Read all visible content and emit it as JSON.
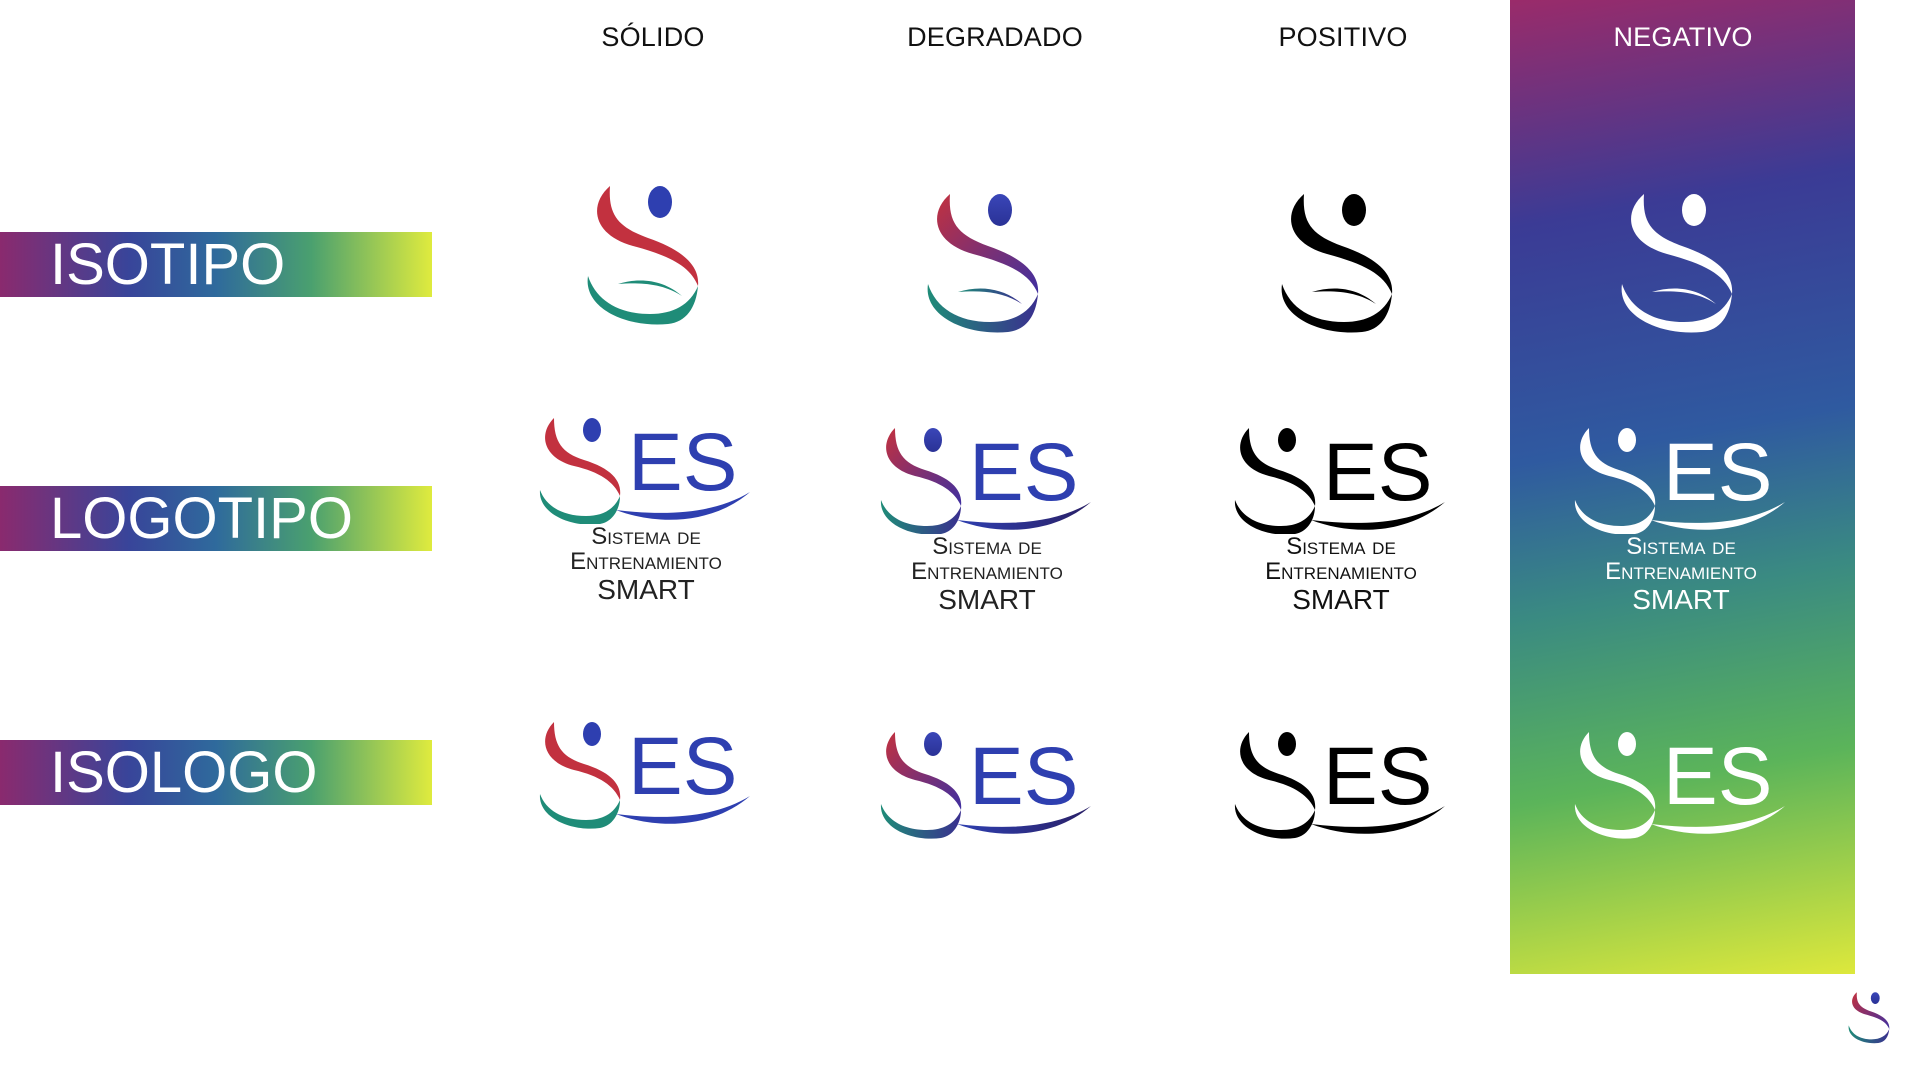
{
  "columns": {
    "solid": "SÓLIDO",
    "gradient": "DEGRADADO",
    "positive": "POSITIVO",
    "negative": "NEGATIVO"
  },
  "rows": {
    "isotipo": "ISOTIPO",
    "logotipo": "LOGOTIPO",
    "isologo": "ISOLOGO"
  },
  "brand": {
    "letters": "ES",
    "tagline_line1": "Sistema de",
    "tagline_line2": "Entrenamiento",
    "tagline_line3": "SMART"
  },
  "colors": {
    "red": "#c2313f",
    "teal": "#1f8c78",
    "blue": "#2e3fb0",
    "black": "#000000",
    "white": "#ffffff"
  }
}
